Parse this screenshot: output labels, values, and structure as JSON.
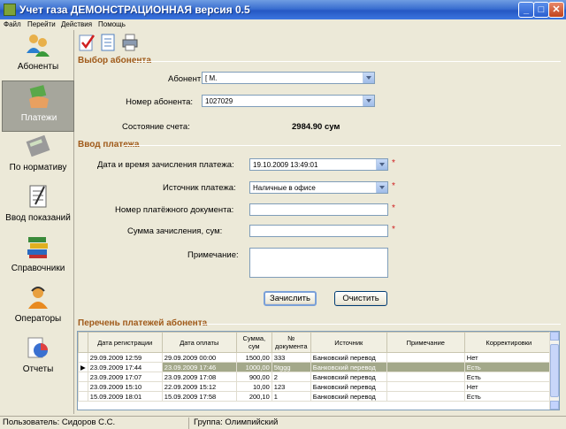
{
  "window": {
    "title": "Учет газа ДЕМОНСТРАЦИОННАЯ версия 0.5",
    "min": "_",
    "max": "□",
    "close": "✕"
  },
  "menu": [
    "Файл",
    "Перейти",
    "Действия",
    "Помощь"
  ],
  "sidebar": {
    "items": [
      {
        "label": "Абоненты",
        "icon": "users-icon"
      },
      {
        "label": "Платежи",
        "icon": "hand-money-icon"
      },
      {
        "label": "По нормативу",
        "icon": "calculator-icon"
      },
      {
        "label": "Ввод показаний",
        "icon": "notepad-icon"
      },
      {
        "label": "Справочники",
        "icon": "books-icon"
      },
      {
        "label": "Операторы",
        "icon": "operator-icon"
      },
      {
        "label": "Отчеты",
        "icon": "report-chart-icon"
      }
    ],
    "active_index": 1
  },
  "toolbar": [
    "checklist-icon",
    "document-icon",
    "printer-icon"
  ],
  "subscriber_section": {
    "title": "Выбор абонента",
    "subscriber_label": "Абонент:",
    "subscriber_value": "[          М.",
    "number_label": "Номер абонента:",
    "number_value": "1027029",
    "balance_label": "Состояние счета:",
    "balance_value": "2984.90 сум"
  },
  "payment_section": {
    "title": "Ввод платежа",
    "datetime_label": "Дата и время зачисления платежа:",
    "datetime_value": "19.10.2009 13:49:01",
    "source_label": "Источник платежа:",
    "source_value": "Наличные в офисе",
    "doc_label": "Номер платёжного документа:",
    "doc_value": "",
    "sum_label": "Сумма зачисления, сум:",
    "sum_value": "",
    "note_label": "Примечание:",
    "note_value": "",
    "required_mark": "*",
    "submit_label": "Зачислить",
    "clear_label": "Очистить"
  },
  "payments_table": {
    "title": "Перечень платежей абонента",
    "columns": [
      "Дата регистрации",
      "Дата оплаты",
      "Сумма, сум",
      "№ документа",
      "Источник",
      "Примечание",
      "Корректировки"
    ],
    "rows": [
      [
        "29.09.2009 12:59",
        "29.09.2009 00:00",
        "1500,00",
        "333",
        "Банковский перевод",
        "",
        "Нет"
      ],
      [
        "23.09.2009 17:44",
        "23.09.2009 17:46",
        "1000,00",
        "5tggg",
        "Банковский перевод",
        "",
        "Есть"
      ],
      [
        "23.09.2009 17:07",
        "23.09.2009 17:08",
        "900,00",
        "2",
        "Банковский перевод",
        "",
        "Есть"
      ],
      [
        "23.09.2009 15:10",
        "22.09.2009 15:12",
        "10,00",
        "123",
        "Банковский перевод",
        "",
        "Нет"
      ],
      [
        "15.09.2009 18:01",
        "15.09.2009 17:58",
        "200,10",
        "1",
        "Банковский перевод",
        "",
        "Есть"
      ]
    ],
    "selected_row": 1
  },
  "status": {
    "user": "Пользователь: Сидоров  С.С.",
    "group": "Группа: Олимпийский"
  }
}
